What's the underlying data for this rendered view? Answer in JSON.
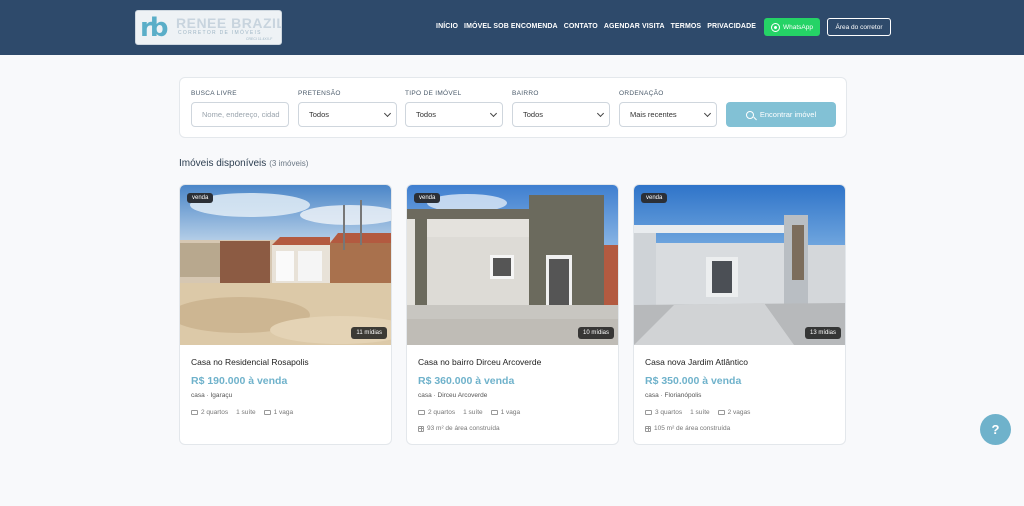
{
  "brand": {
    "mark": "rb",
    "name": "RENEE BRAZIL",
    "subtitle": "CORRETOR DE IMÓVEIS",
    "tagline": "CRECI 11.4XX-F"
  },
  "nav": {
    "items": [
      "INÍCIO",
      "IMÓVEL SOB ENCOMENDA",
      "CONTATO",
      "AGENDAR VISITA",
      "TERMOS",
      "PRIVACIDADE"
    ],
    "whatsapp_label": "WhatsApp",
    "broker_label": "Área do corretor"
  },
  "filters": {
    "search_label": "BUSCA LIVRE",
    "search_placeholder": "Nome, endereço, cidad",
    "purpose_label": "PRETENSÃO",
    "purpose_value": "Todos",
    "type_label": "TIPO DE IMÓVEL",
    "type_value": "Todos",
    "district_label": "BAIRRO",
    "district_value": "Todos",
    "sort_label": "ORDENAÇÃO",
    "sort_value": "Mais recentes",
    "find_button": "Encontrar imóvel"
  },
  "listing": {
    "title": "Imóveis disponíveis",
    "count": "(3 imóveis)"
  },
  "cards": [
    {
      "badge": "venda",
      "media": "11 mídias",
      "title": "Casa no Residencial Rosapolis",
      "price": "R$ 190.000 à venda",
      "location": "casa · Igaraçu",
      "bedrooms": "2 quartos",
      "suites": "1 suíte",
      "parking": "1 vaga",
      "area": ""
    },
    {
      "badge": "venda",
      "media": "10 mídias",
      "title": "Casa no bairro Dirceu Arcoverde",
      "price": "R$ 360.000 à venda",
      "location": "casa · Dirceu Arcoverde",
      "bedrooms": "2 quartos",
      "suites": "1 suíte",
      "parking": "1 vaga",
      "area": "93 m² de área construída"
    },
    {
      "badge": "venda",
      "media": "13 mídias",
      "title": "Casa nova Jardim Atlântico",
      "price": "R$ 350.000 à venda",
      "location": "casa · Florianópolis",
      "bedrooms": "3 quartos",
      "suites": "1 suíte",
      "parking": "2 vagas",
      "area": "105 m² de área construída"
    }
  ],
  "help": {
    "label": "?"
  },
  "colors": {
    "header": "#2e4a6b",
    "accent": "#6fb2cb",
    "whatsapp": "#25d366",
    "background": "#f8f9fb"
  }
}
